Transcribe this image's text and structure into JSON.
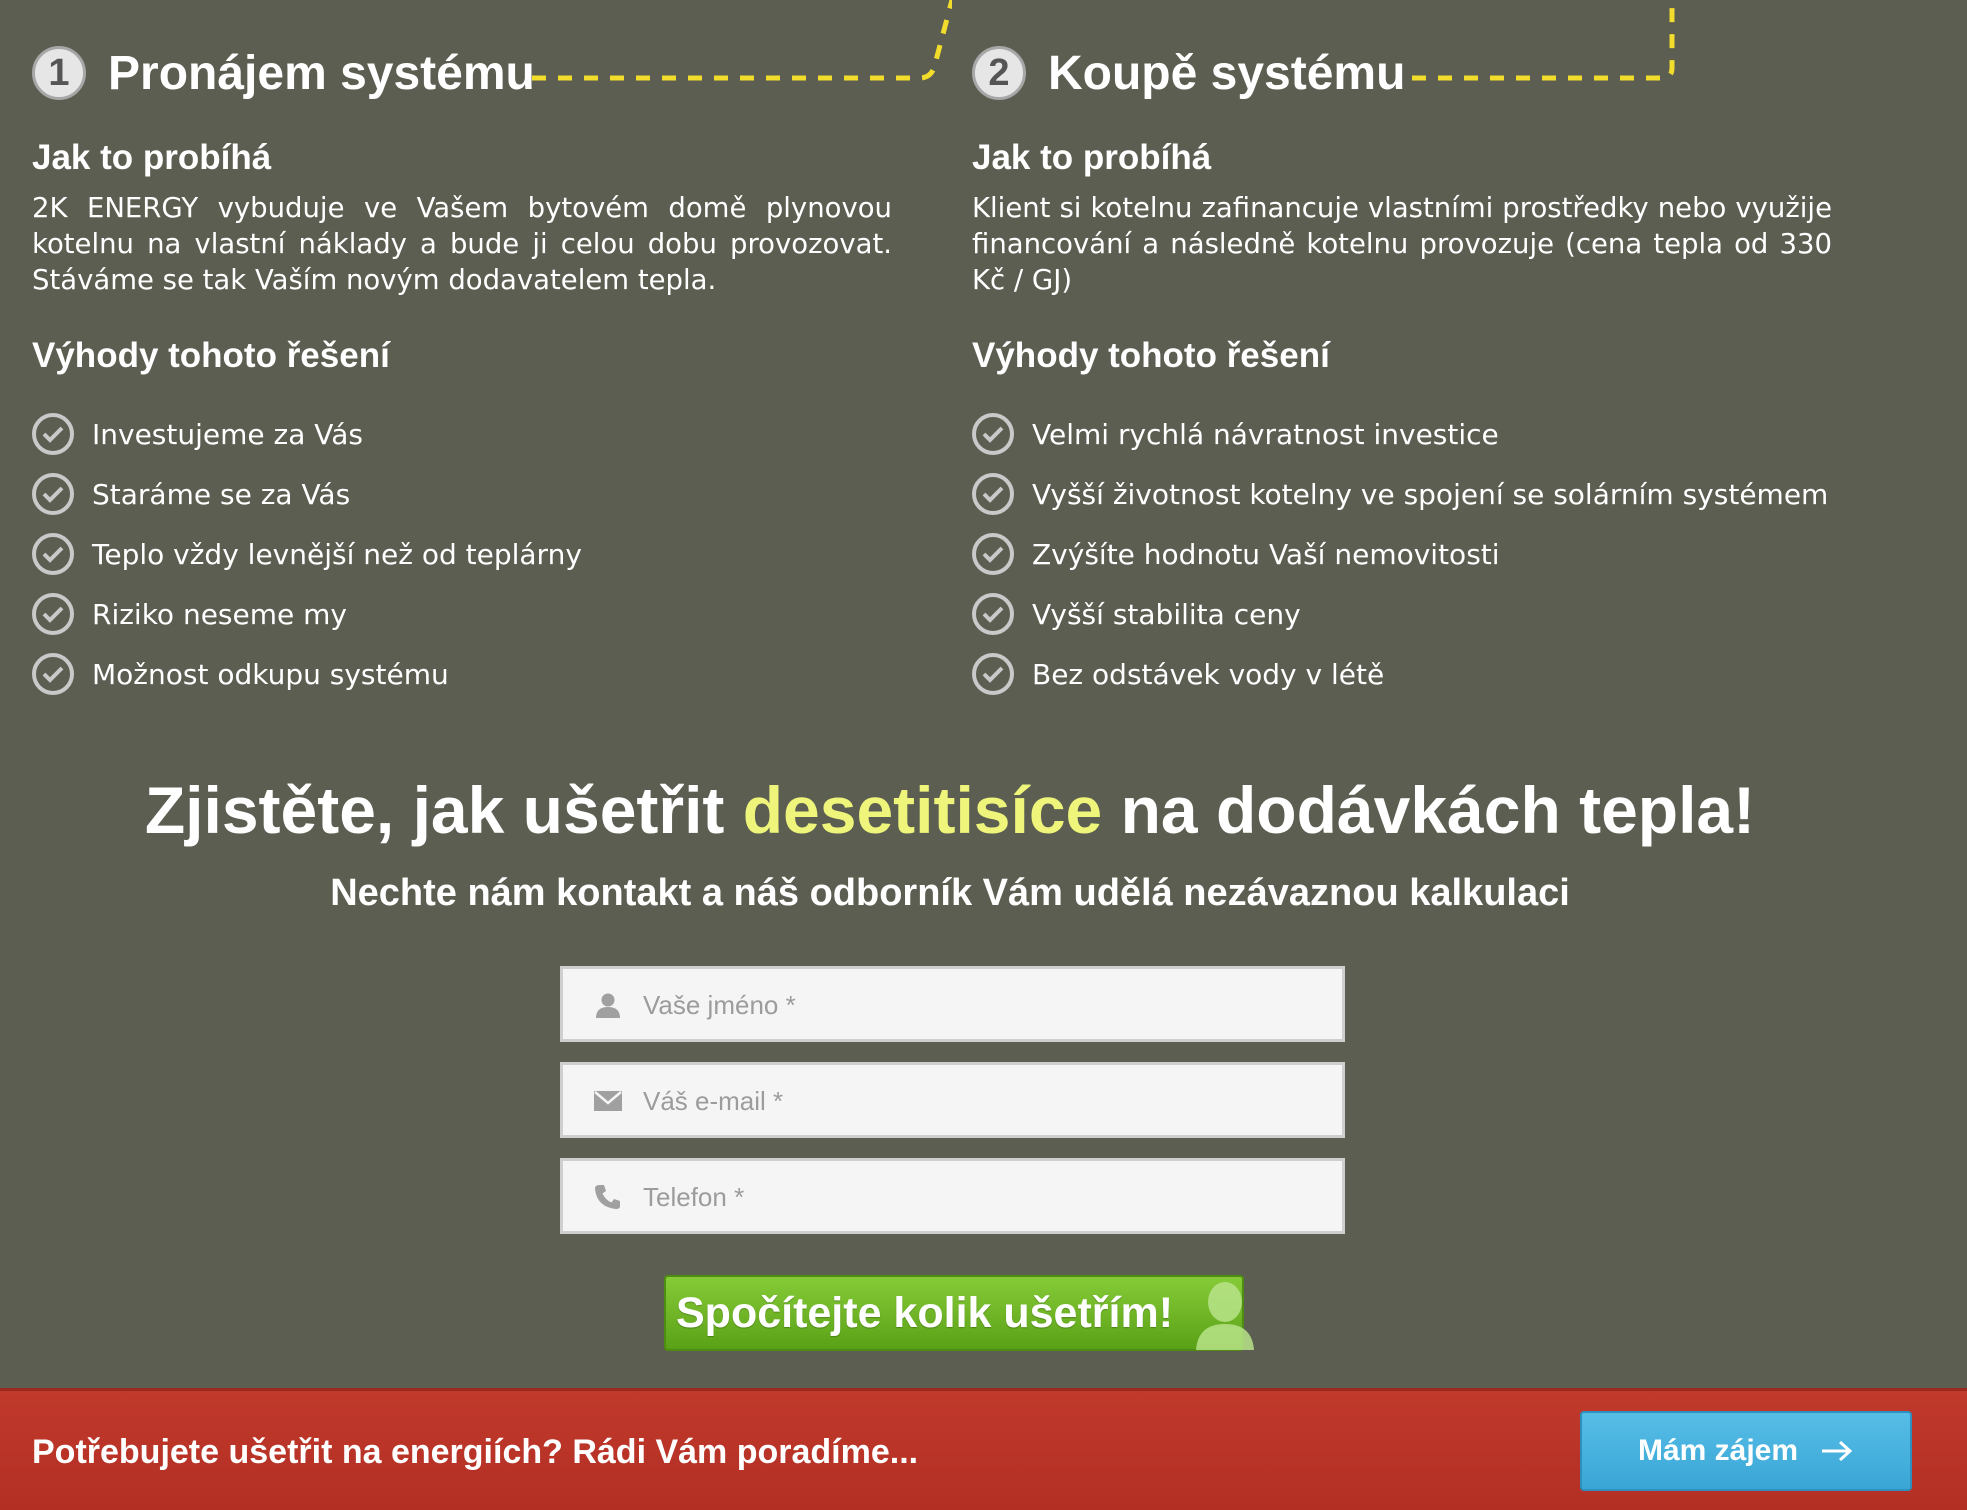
{
  "options": [
    {
      "number": "1",
      "title": "Pronájem systému",
      "how_heading": "Jak to probíhá",
      "description": "2K ENERGY vybuduje ve Vašem bytovém domě plynovou kotelnu na vlastní náklady a bude ji celou dobu provozovat. Stáváme se tak Vaším novým dodavatelem tepla.",
      "benefits_heading": "Výhody tohoto řešení",
      "benefits": [
        "Investujeme za Vás",
        "Staráme se za Vás",
        "Teplo vždy levnější než od teplárny",
        "Riziko neseme my",
        "Možnost odkupu systému"
      ]
    },
    {
      "number": "2",
      "title": "Koupě systému",
      "how_heading": "Jak to probíhá",
      "description": "Klient si kotelnu zafinancuje vlastními prostředky nebo využije financování a následně kotelnu provozuje (cena tepla od 330 Kč / GJ)",
      "benefits_heading": "Výhody tohoto řešení",
      "benefits": [
        "Velmi rychlá návratnost investice",
        "Vyšší životnost kotelny ve spojení se solárním systémem",
        "Zvýšíte hodnotu Vaší nemovitosti",
        "Vyšší stabilita ceny",
        "Bez odstávek vody v létě"
      ]
    }
  ],
  "headline": {
    "before": "Zjistěte, jak ušetřit ",
    "highlight": "desetitisíce",
    "after": " na dodávkách tepla!",
    "subheadline": "Nechte nám kontakt a náš odborník Vám udělá nezávaznou kalkulaci"
  },
  "form": {
    "name_placeholder": "Vaše jméno *",
    "email_placeholder": "Váš e-mail *",
    "phone_placeholder": "Telefon *",
    "submit_label": "Spočítejte kolik ušetřím!"
  },
  "bottom_bar": {
    "text": "Potřebujete ušetřit na energiích? Rádi Vám poradíme...",
    "button_label": "Mám zájem"
  },
  "colors": {
    "background": "#5b5e51",
    "highlight": "#eef57a",
    "dashed_path": "#f2dc2c",
    "cta_green": "#6eb525",
    "bar_red": "#c0392b",
    "bar_button_blue": "#4cb2df"
  },
  "icons": {
    "benefit": "check-circle-icon",
    "name_field": "user-icon",
    "email_field": "envelope-icon",
    "phone_field": "phone-icon",
    "submit": "person-silhouette-icon",
    "bar_button": "arrow-right-icon"
  }
}
